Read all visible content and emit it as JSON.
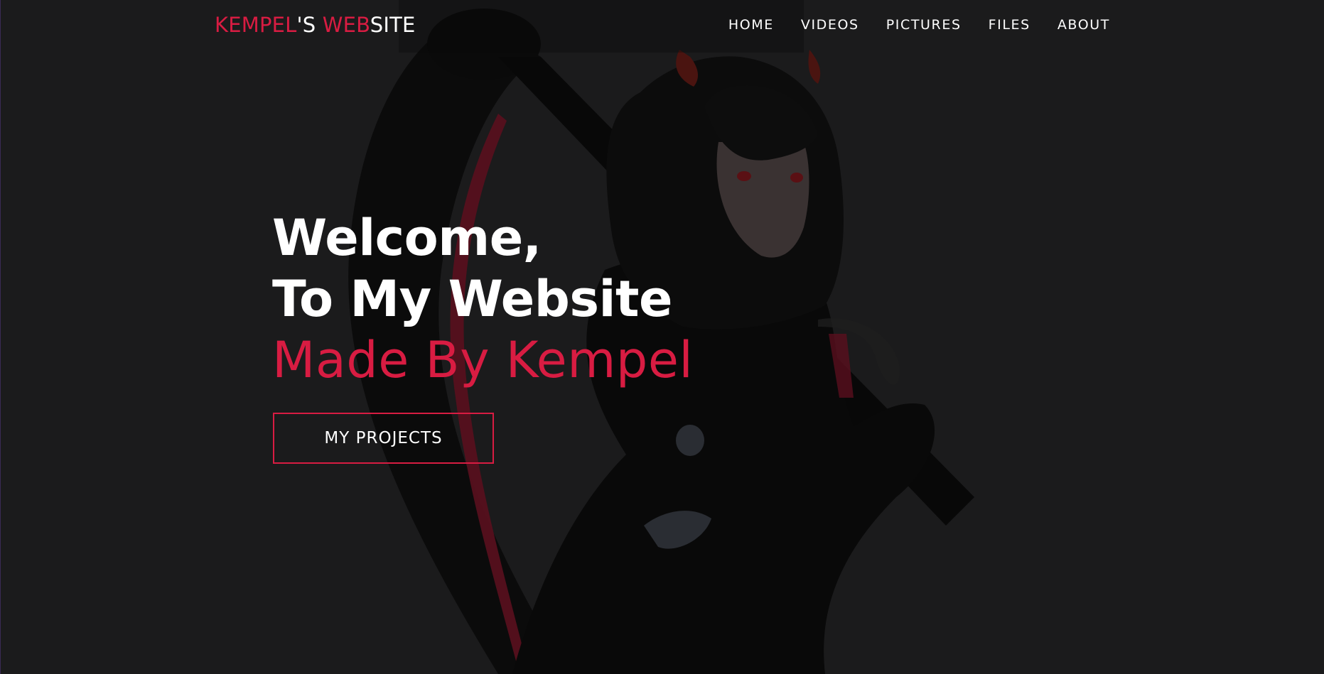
{
  "header": {
    "logo_part1": "KEMPEL",
    "logo_part2": "'S ",
    "logo_part3": "WEB",
    "logo_part4": "SITE",
    "nav": [
      {
        "label": "HOME"
      },
      {
        "label": "VIDEOS"
      },
      {
        "label": "PICTURES"
      },
      {
        "label": "FILES"
      },
      {
        "label": "ABOUT"
      }
    ]
  },
  "hero": {
    "line1": "Welcome,",
    "line2": "To My Website",
    "line3": "Made By Kempel",
    "button_label": "MY PROJECTS"
  },
  "colors": {
    "background": "#1b1b1c",
    "accent": "#d81c42",
    "text": "#ffffff"
  }
}
